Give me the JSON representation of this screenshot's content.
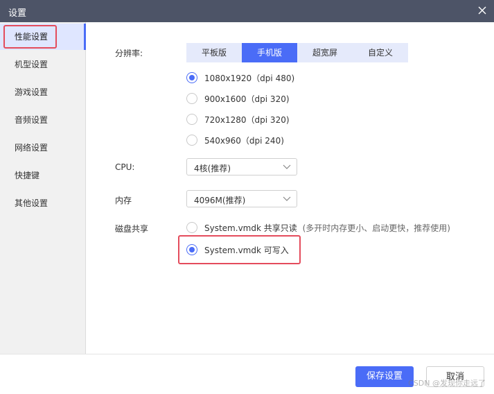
{
  "window": {
    "title": "设置"
  },
  "sidebar": {
    "items": [
      {
        "label": "性能设置",
        "active": true
      },
      {
        "label": "机型设置"
      },
      {
        "label": "游戏设置"
      },
      {
        "label": "音频设置"
      },
      {
        "label": "网络设置"
      },
      {
        "label": "快捷键"
      },
      {
        "label": "其他设置"
      }
    ]
  },
  "resolution": {
    "label": "分辨率:",
    "tabs": [
      {
        "label": "平板版"
      },
      {
        "label": "手机版",
        "active": true
      },
      {
        "label": "超宽屏"
      },
      {
        "label": "自定义"
      }
    ],
    "options": [
      {
        "label": "1080x1920（dpi 480)",
        "selected": true
      },
      {
        "label": "900x1600（dpi 320)"
      },
      {
        "label": "720x1280（dpi 320)"
      },
      {
        "label": "540x960（dpi 240)"
      }
    ]
  },
  "cpu": {
    "label": "CPU:",
    "value": "4核(推荐)"
  },
  "memory": {
    "label": "内存",
    "value": "4096M(推荐)"
  },
  "disk": {
    "label": "磁盘共享",
    "options": [
      {
        "label": "System.vmdk 共享只读",
        "hint": "(多开时内存更小、启动更快，推荐使用)"
      },
      {
        "label": "System.vmdk 可写入",
        "selected": true
      }
    ]
  },
  "footer": {
    "save_label": "保存设置",
    "cancel_label": "取消"
  },
  "watermark": "CSDN @发现你走远了",
  "colors": {
    "accent": "#4a6cf7",
    "highlight": "#e44b5c",
    "titlebar": "#4d5467"
  }
}
